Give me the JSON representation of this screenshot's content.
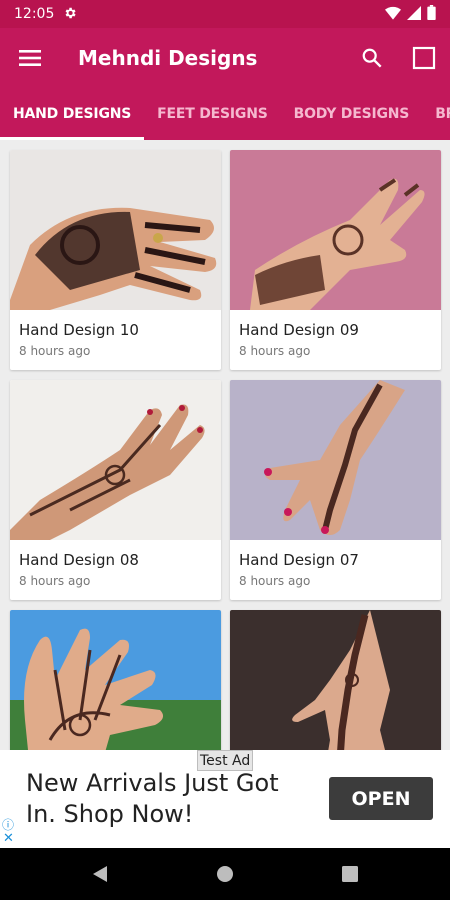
{
  "status_bar": {
    "time": "12:05"
  },
  "app_bar": {
    "title": "Mehndi Designs"
  },
  "tabs": [
    {
      "label": "HAND DESIGNS"
    },
    {
      "label": "FEET DESIGNS"
    },
    {
      "label": "BODY DESIGNS"
    },
    {
      "label": "BRIDAL DESIGNS"
    }
  ],
  "cards": [
    {
      "title": "Hand Design 10",
      "time": "8 hours ago"
    },
    {
      "title": "Hand Design 09",
      "time": "8 hours ago"
    },
    {
      "title": "Hand Design 08",
      "time": "8 hours ago"
    },
    {
      "title": "Hand Design 07",
      "time": "8 hours ago"
    },
    {
      "title": "",
      "time": ""
    },
    {
      "title": "",
      "time": ""
    }
  ],
  "ad": {
    "badge": "Test Ad",
    "text": "New Arrivals Just Got In. Shop Now!",
    "button": "OPEN",
    "info_icon": "ⓘ",
    "close_icon": "✕"
  },
  "colors": {
    "primary": "#c2185b",
    "status_bar": "#b8134f",
    "tab_inactive": "#f5b8cf"
  },
  "icons": [
    "settings-icon",
    "wifi-icon",
    "signal-icon",
    "battery-icon",
    "menu-icon",
    "search-icon",
    "square-icon",
    "back-icon",
    "home-icon",
    "recents-icon"
  ]
}
